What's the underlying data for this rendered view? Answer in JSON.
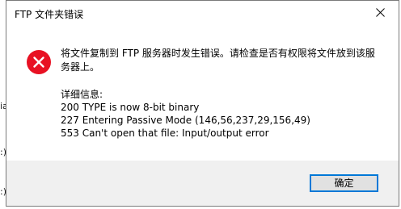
{
  "background": {
    "fragments": [
      "ia",
      ":)",
      ":)"
    ]
  },
  "dialog": {
    "title": "FTP 文件夹错误",
    "icon": "error-icon",
    "message": "将文件复制到 FTP 服务器时发生错误。请检查是否有权限将文件放到该服务器上。",
    "details": [
      "详细信息:",
      "200 TYPE is now 8-bit binary",
      "227 Entering Passive Mode (146,56,237,29,156,49)",
      "553 Can't open that file: Input/output error"
    ],
    "ok_label": "确定",
    "colors": {
      "error_red": "#e81123",
      "button_focus_border": "#0078d7",
      "footer_bg": "#f0f0f0"
    }
  }
}
